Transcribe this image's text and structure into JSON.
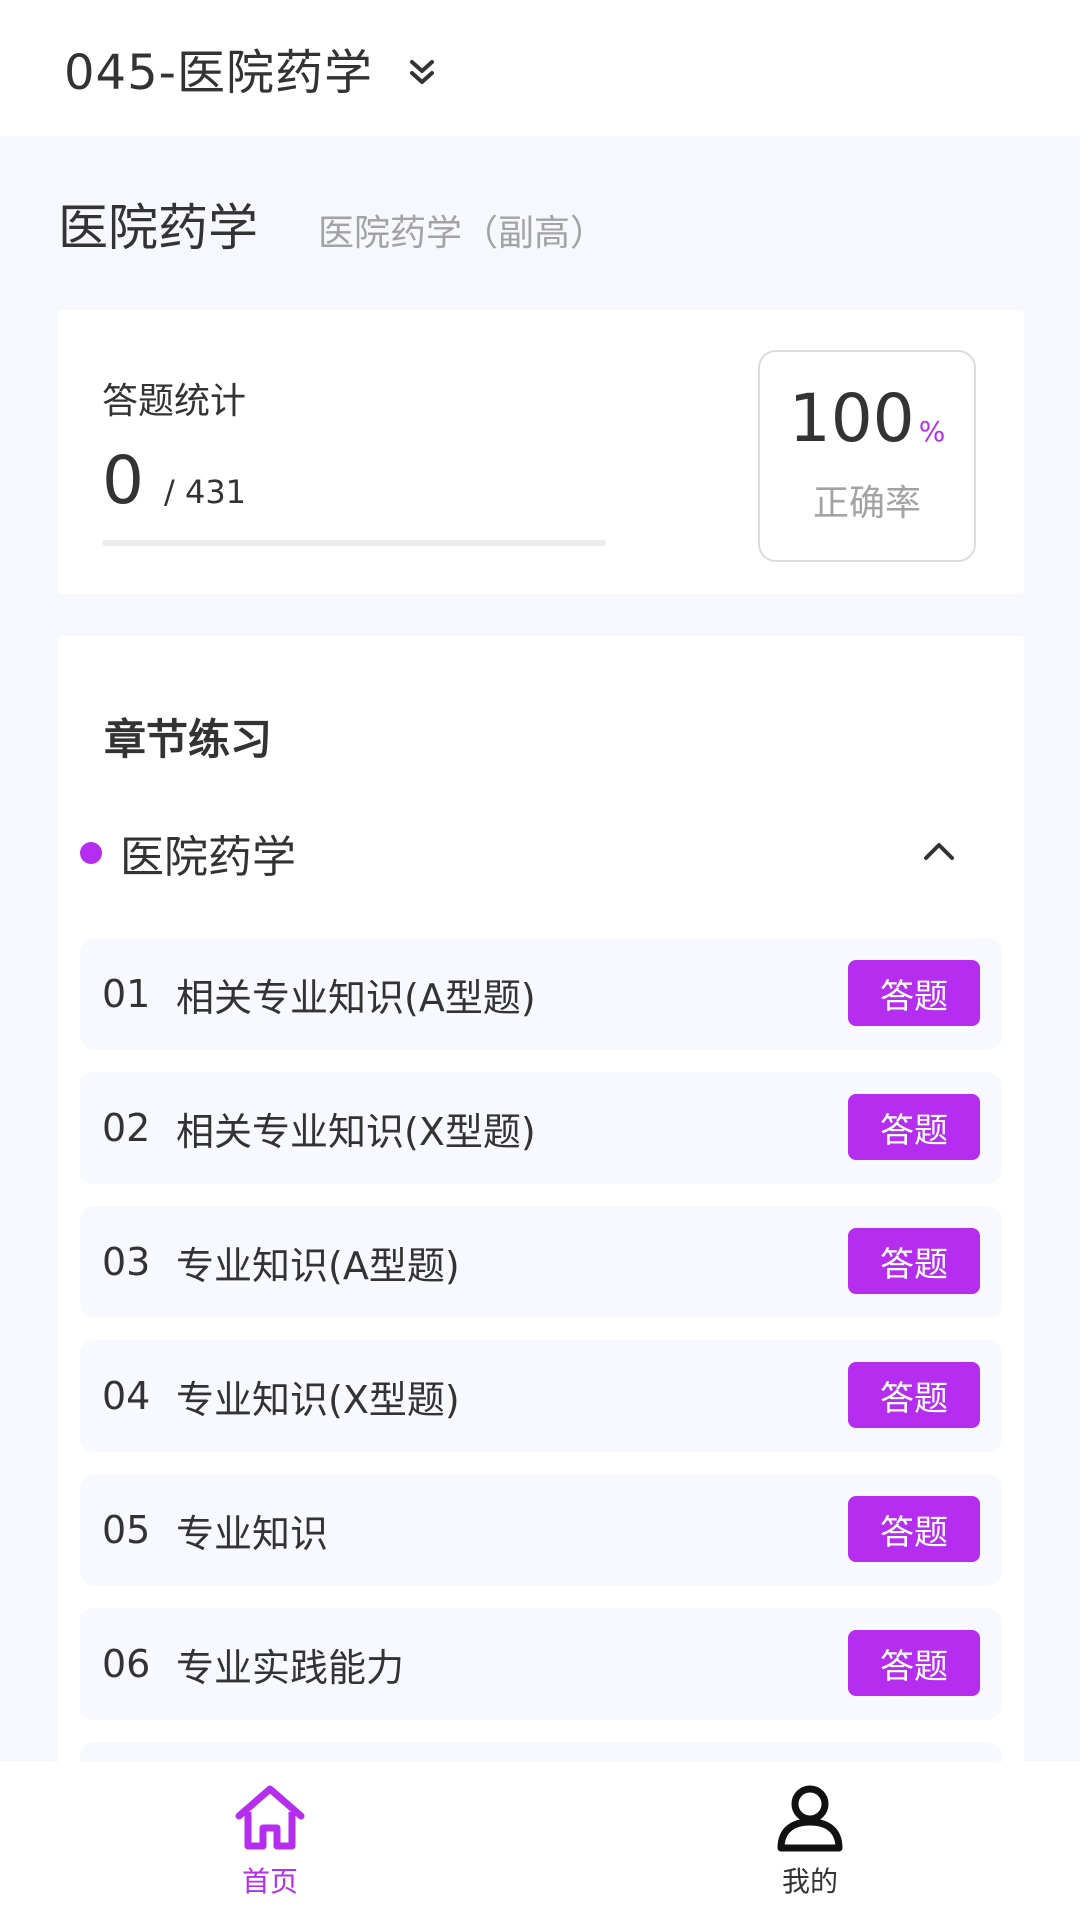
{
  "header": {
    "title": "045-医院药学",
    "dropdown_icon": "double-chevron-down-icon"
  },
  "subject": {
    "name": "医院药学",
    "level": "医院药学（副高）"
  },
  "stats": {
    "label": "答题统计",
    "answered": "0",
    "total": "/ 431",
    "progress_percent": 0,
    "rate_value": "100",
    "rate_unit": "%",
    "rate_label": "正确率"
  },
  "chapters": {
    "heading": "章节练习",
    "group_name": "医院药学",
    "group_state": "expanded",
    "items": [
      {
        "index": "01",
        "name": "相关专业知识(A型题)",
        "action": "答题"
      },
      {
        "index": "02",
        "name": "相关专业知识(X型题)",
        "action": "答题"
      },
      {
        "index": "03",
        "name": "专业知识(A型题)",
        "action": "答题"
      },
      {
        "index": "04",
        "name": "专业知识(X型题)",
        "action": "答题"
      },
      {
        "index": "05",
        "name": "专业知识",
        "action": "答题"
      },
      {
        "index": "06",
        "name": "专业实践能力",
        "action": "答题"
      }
    ]
  },
  "nav": {
    "home_label": "首页",
    "mine_label": "我的",
    "active": "home"
  },
  "colors": {
    "accent": "#b52ef0",
    "background": "#f6f8fd",
    "item_background": "#f8f9fe"
  }
}
